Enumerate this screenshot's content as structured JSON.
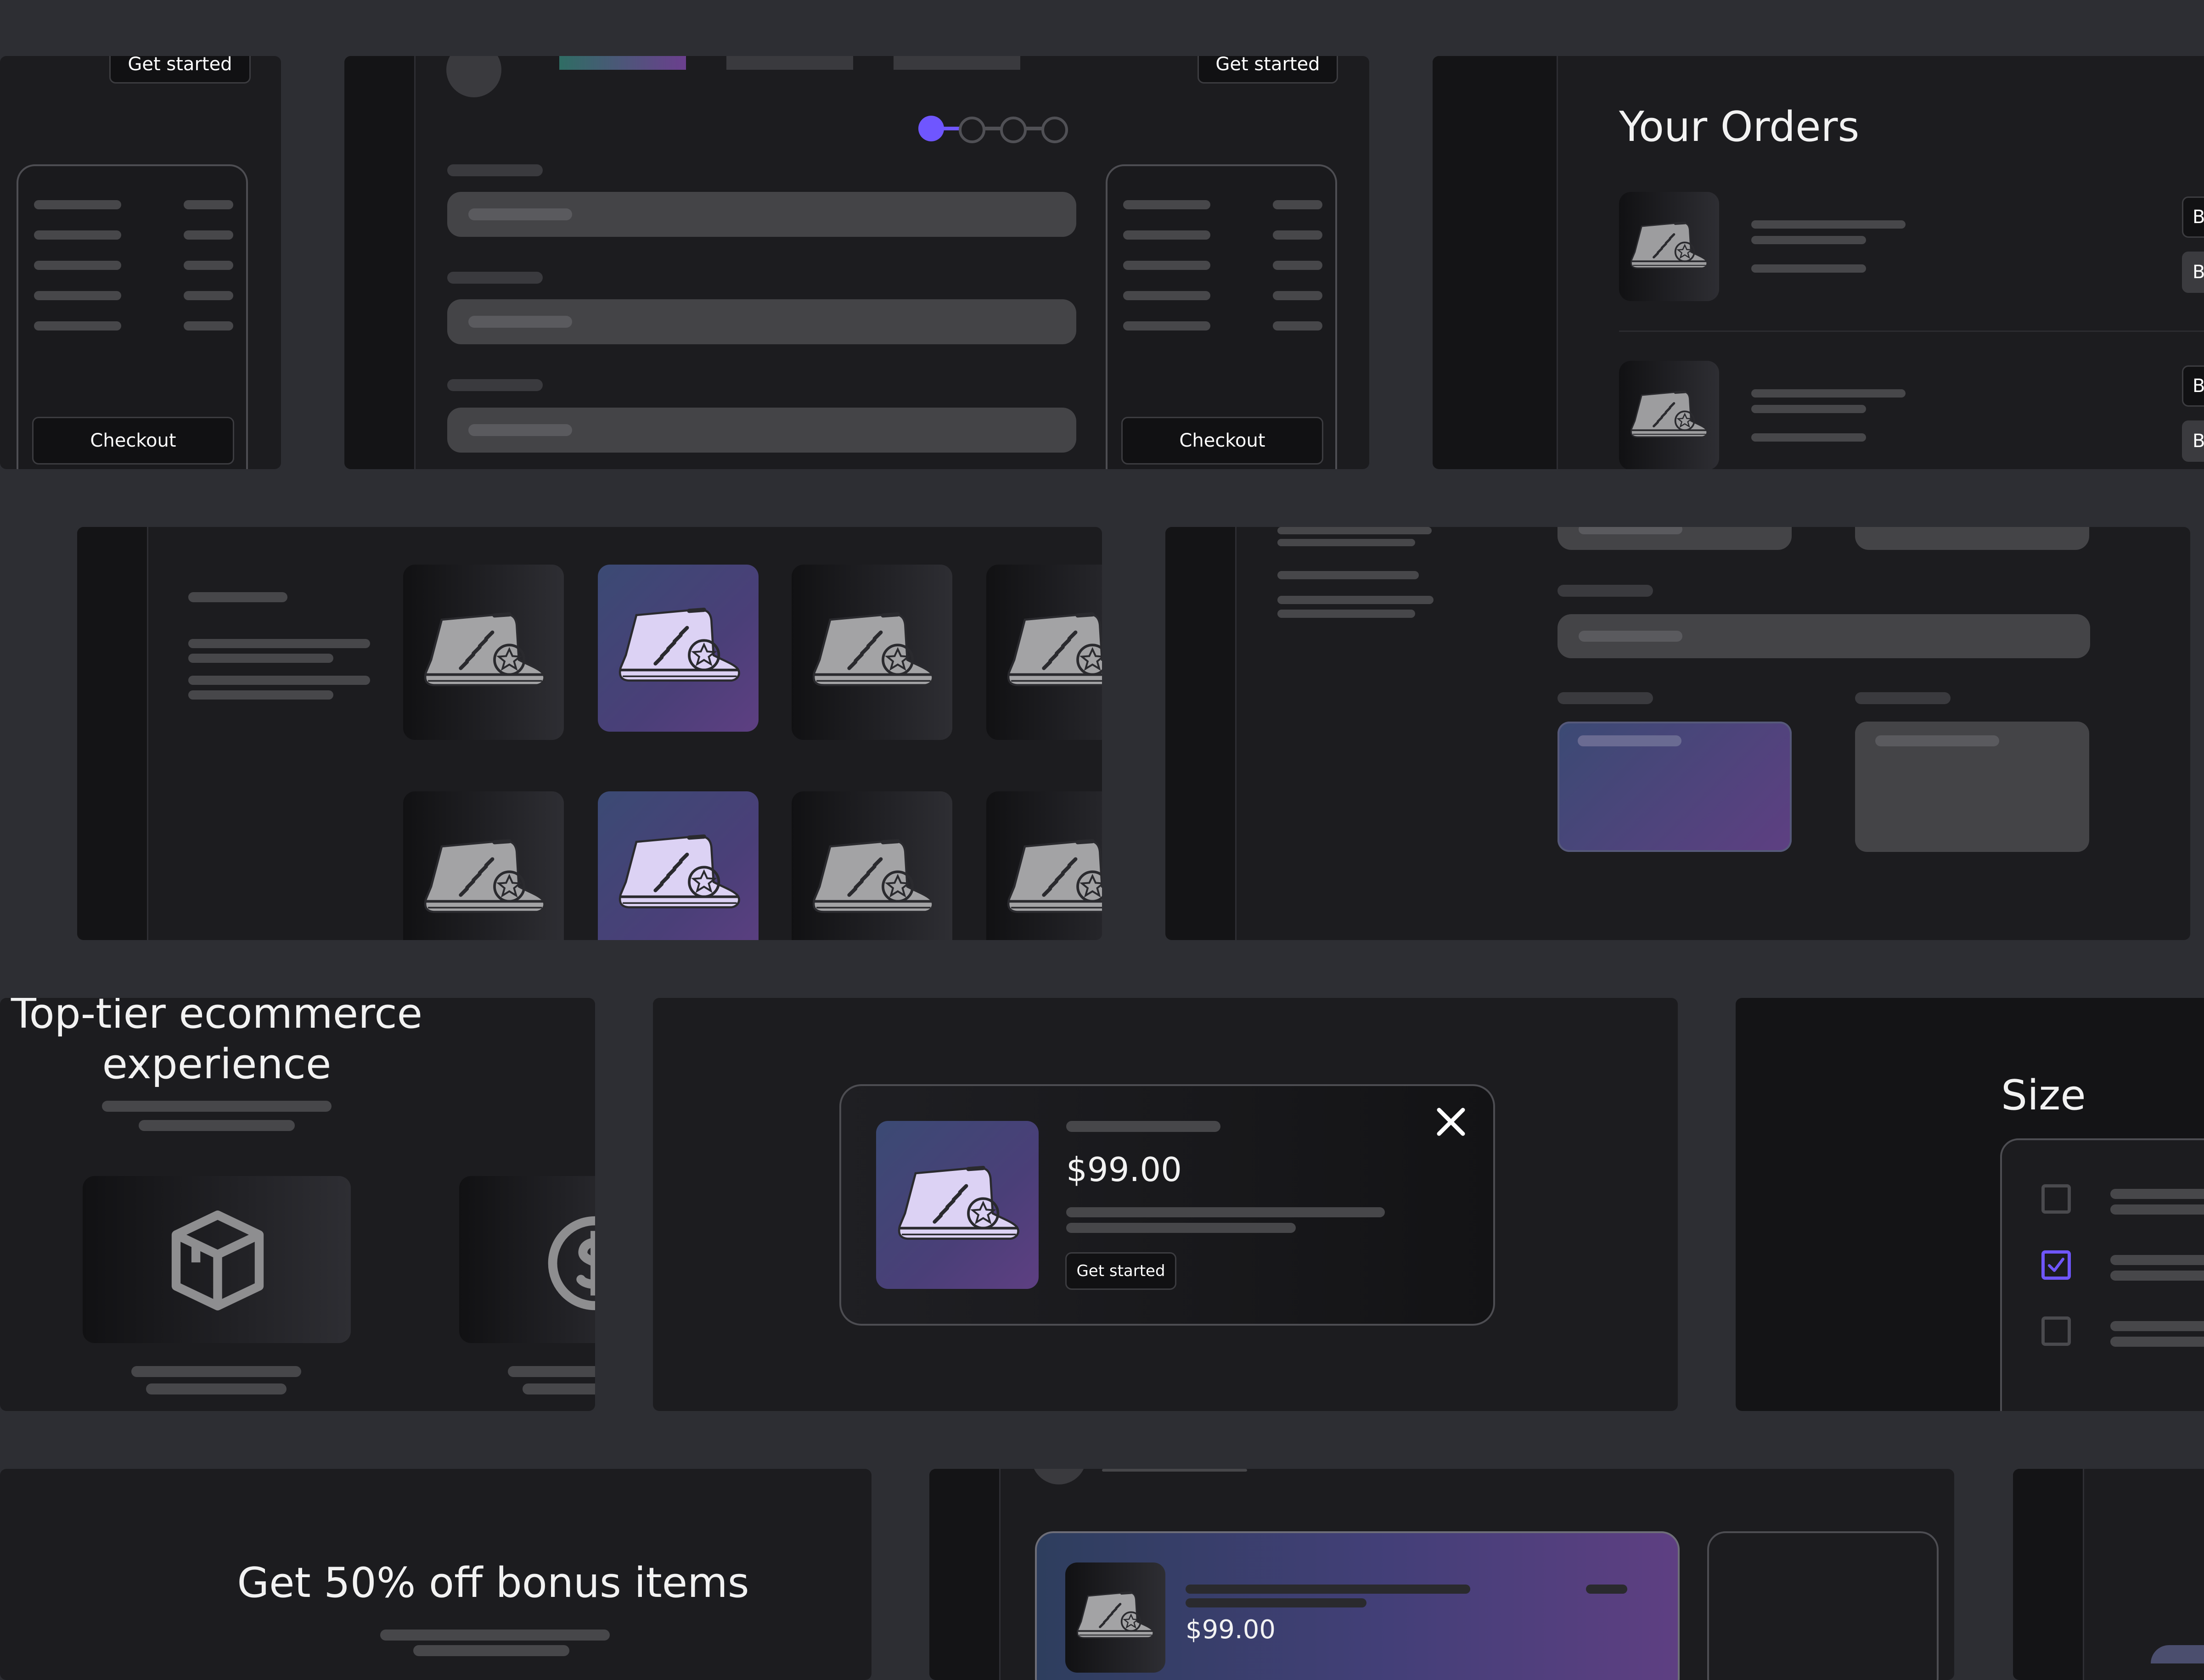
{
  "buttons": {
    "get_started": "Get started",
    "checkout": "Checkout",
    "bu_cut": "B"
  },
  "orders": {
    "title": "Your Orders"
  },
  "promo": {
    "headline_line1": "Top-tier ecommerce",
    "headline_line2": "experience",
    "bonus": "Get 50% off bonus items"
  },
  "product_modal": {
    "price": "$99.00",
    "cta": "Get started"
  },
  "size_filter": {
    "title": "Size",
    "options": [
      {
        "checked": false
      },
      {
        "checked": true
      },
      {
        "checked": false
      }
    ]
  },
  "cart_item": {
    "price": "$99.00"
  },
  "stepper": {
    "steps": 4,
    "active_step": 1
  },
  "colors": {
    "background": "#2d2e33",
    "card": "#1c1c1f",
    "accent": "#6f56ff",
    "gradient_start": "#3b4a74",
    "gradient_end": "#5e3f82"
  },
  "icons": [
    "sneaker-icon",
    "close-icon",
    "box-icon",
    "dollar-icon",
    "check-icon"
  ]
}
